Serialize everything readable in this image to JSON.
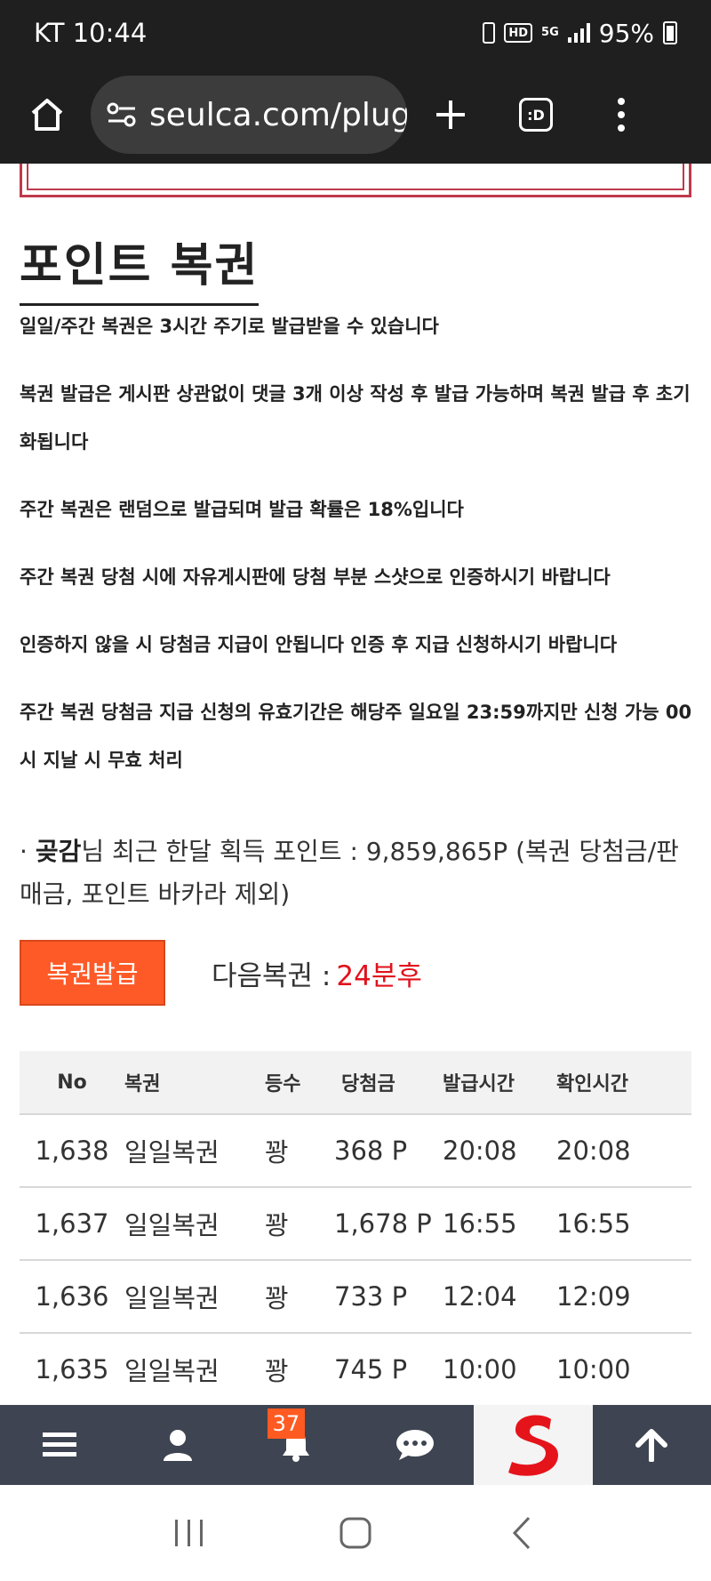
{
  "status_bar": {
    "carrier_time": "KT 10:44",
    "hd": "HD",
    "network": "5G",
    "battery": "95%"
  },
  "browser": {
    "url": "seulca.com/plug",
    "tab_count": ":D"
  },
  "section": {
    "title": "포인트 복권"
  },
  "rules": [
    "일일/주간 복권은 3시간 주기로 발급받을 수 있습니다",
    "복권 발급은 게시판 상관없이 댓글 3개 이상 작성 후 발급 가능하며 복권 발급 후 초기화됩니다",
    "주간 복권은 랜덤으로 발급되며 발급 확률은 18%입니다",
    "주간 복권 당첨 시에 자유게시판에 당첨 부분 스샷으로 인증하시기 바랍니다",
    "인증하지 않을 시 당첨금 지급이 안됩니다 인증 후 지급 신청하시기 바랍니다",
    "주간 복권 당첨금 지급 신청의 유효기간은 해당주 일요일 23:59까지만 신청 가능 00시 지날 시 무효 처리"
  ],
  "points": {
    "bullet": "·",
    "user": "곶감",
    "suffix": "님 최근 한달 획득 포인트 : 9,859,865P (복권 당첨금/판매금, 포인트 바카라 제외)"
  },
  "issue": {
    "button": "복권발급",
    "next_label": "다음복권 :",
    "next_value": "24분후"
  },
  "table": {
    "headers": [
      "No",
      "복권",
      "등수",
      "당첨금",
      "발급시간",
      "확인시간"
    ],
    "rows": [
      [
        "1,638",
        "일일복권",
        "꽝",
        "368 P",
        "20:08",
        "20:08"
      ],
      [
        "1,637",
        "일일복권",
        "꽝",
        "1,678 P",
        "16:55",
        "16:55"
      ],
      [
        "1,636",
        "일일복권",
        "꽝",
        "733 P",
        "12:04",
        "12:09"
      ],
      [
        "1,635",
        "일일복권",
        "꽝",
        "745 P",
        "10:00",
        "10:00"
      ]
    ]
  },
  "bottom_nav": {
    "notification_count": "37"
  },
  "colors": {
    "accent": "#fe5a28",
    "next_time": "#e0121c",
    "nav_bg": "#3e4451",
    "notice_border": "#c0394b"
  }
}
